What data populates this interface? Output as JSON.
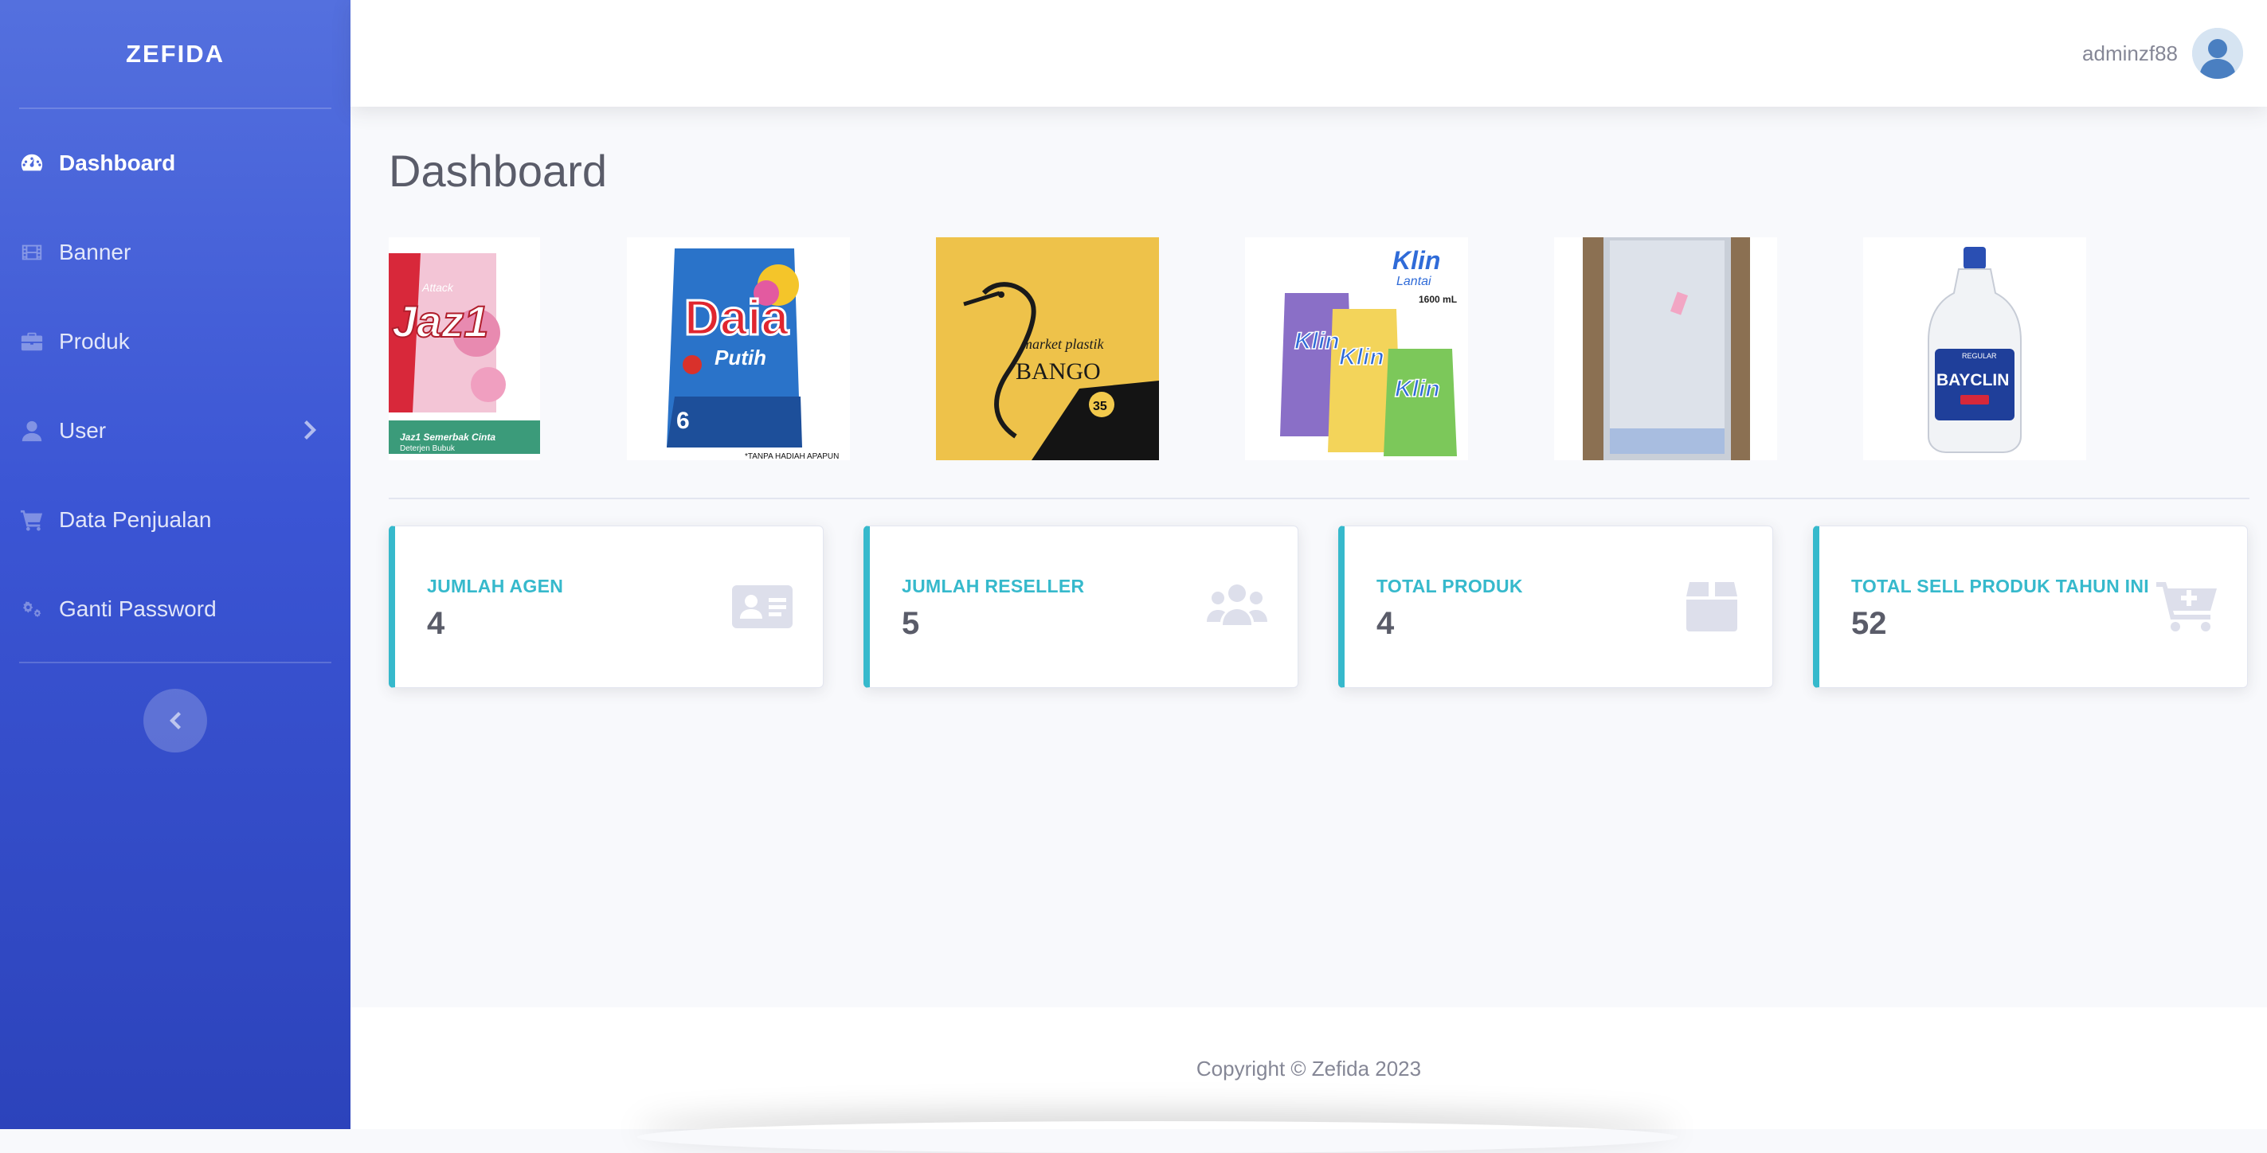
{
  "sidebar": {
    "brand": "ZEFIDA",
    "items": [
      {
        "label": "Dashboard",
        "icon": "tachometer-icon",
        "active": true
      },
      {
        "label": "Banner",
        "icon": "film-icon"
      },
      {
        "label": "Produk",
        "icon": "briefcase-icon"
      },
      {
        "label": "User",
        "icon": "user-icon",
        "has_submenu": true
      },
      {
        "label": "Data Penjualan",
        "icon": "cart-icon"
      },
      {
        "label": "Ganti Password",
        "icon": "cogs-icon"
      }
    ],
    "toggle_icon": "chevron-left-icon"
  },
  "topbar": {
    "username": "adminzf88",
    "avatar_icon": "user-avatar-icon"
  },
  "main": {
    "title": "Dashboard",
    "banners": [
      {
        "name": "Attack Jaz1 detergent",
        "texts": [
          "Attack",
          "Jaz1",
          "Jaz1 Semerbak Cinta",
          "Deterjen Bubuk"
        ]
      },
      {
        "name": "Daia Putih detergent",
        "texts": [
          "Daia",
          "Putih",
          "6",
          "*TANPA HADIAH APAPUN"
        ]
      },
      {
        "name": "Bango plastic bag",
        "texts": [
          "market plastik",
          "BANGO",
          "35"
        ]
      },
      {
        "name": "So Klin Lantai",
        "texts": [
          "Klin",
          "Lantai",
          "1600 mL"
        ]
      },
      {
        "name": "Plastic sheet pack",
        "texts": []
      },
      {
        "name": "Bayclin bleach",
        "texts": [
          "BAYCLIN",
          "REGULAR"
        ]
      }
    ],
    "cards": [
      {
        "label": "JUMLAH AGEN",
        "value": "4",
        "icon": "id-card-icon"
      },
      {
        "label": "JUMLAH RESELLER",
        "value": "5",
        "icon": "users-icon"
      },
      {
        "label": "TOTAL PRODUK",
        "value": "4",
        "icon": "box-icon"
      },
      {
        "label": "TOTAL SELL PRODUK TAHUN INI",
        "value": "52",
        "icon": "cart-plus-icon"
      }
    ]
  },
  "footer": {
    "copyright": "Copyright © Zefida 2023"
  },
  "colors": {
    "accent": "#36b9cc",
    "sidebar_top": "#5470de",
    "sidebar_bottom": "#2c43bb",
    "title": "#5a5c69"
  }
}
